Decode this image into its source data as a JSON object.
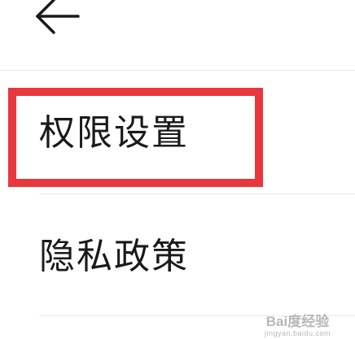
{
  "header": {
    "back_icon": "arrow-left-icon"
  },
  "items": [
    {
      "label": "权限设置"
    },
    {
      "label": "隐私政策"
    }
  ],
  "highlight": {
    "color": "#e8383d",
    "target": "权限设置"
  },
  "watermark": {
    "main": "Bai度经验",
    "sub": "jingyan.baidu.com"
  }
}
